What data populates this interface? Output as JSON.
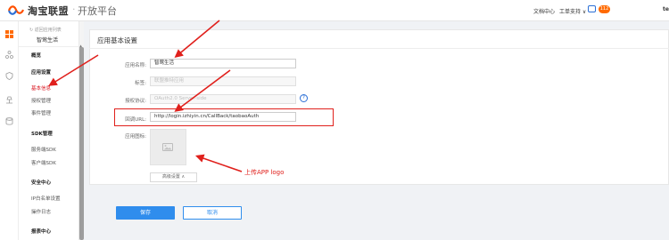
{
  "header": {
    "logo_text": "淘宝联盟",
    "separator": "·",
    "subtitle": "开放平台",
    "links": [
      "文档中心",
      "工单支持 ∨"
    ],
    "badge": "112",
    "user": "te"
  },
  "sidebar": {
    "back": "↻ 返回应用列表",
    "app_name": "智莺生活",
    "items": [
      {
        "label": "概览",
        "type": "head"
      },
      {
        "label": "应用设置",
        "type": "head"
      },
      {
        "label": "基本信息",
        "type": "item",
        "active": true
      },
      {
        "label": "授权管理",
        "type": "item"
      },
      {
        "label": "事件管理",
        "type": "item"
      },
      {
        "label": "SDK管理",
        "type": "head"
      },
      {
        "label": "服务端SDK",
        "type": "item"
      },
      {
        "label": "客户端SDK",
        "type": "item"
      },
      {
        "label": "安全中心",
        "type": "head"
      },
      {
        "label": "IP白名单设置",
        "type": "item"
      },
      {
        "label": "操作日志",
        "type": "item"
      },
      {
        "label": "报表中心",
        "type": "head"
      }
    ]
  },
  "panel": {
    "title": "应用基本设置",
    "fields": {
      "app_name": {
        "label": "应用名称:",
        "value": "智莺生活"
      },
      "tag": {
        "label": "标签:",
        "placeholder": "联盟推特应用"
      },
      "auth_protocol": {
        "label": "授权协议:",
        "placeholder": "OAuth2.0 Server-side"
      },
      "callback": {
        "label": "回调URL:",
        "value": "http://login.izhiyin.cn/CallBack/taobaoAuth"
      },
      "icon": {
        "label": "应用图标:"
      }
    },
    "help_icon": "?",
    "advanced_button": "高级设置 ∧"
  },
  "buttons": {
    "save": "保存",
    "cancel": "取消"
  },
  "annotation": "上传APP logo",
  "colors": {
    "accent": "#2f8ded",
    "annotation_red": "#e0201c",
    "brand_orange": "#ff6a00",
    "active_nav": "#d9131d"
  }
}
